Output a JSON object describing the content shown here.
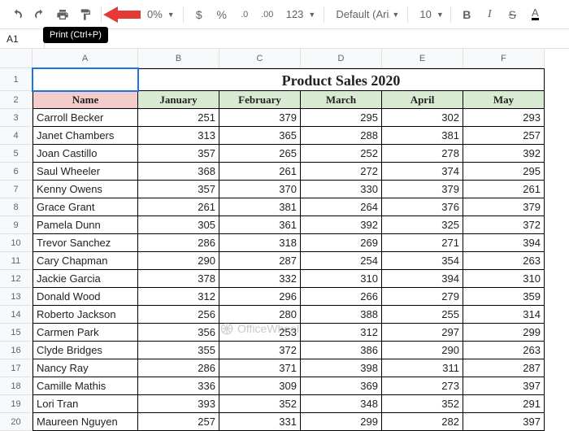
{
  "toolbar": {
    "zoom_tail": "0%",
    "format_123": "123",
    "font_name": "Default (Ari...",
    "font_size": "10"
  },
  "tooltip": {
    "print": "Print (Ctrl+P)"
  },
  "namebox": {
    "value": "A1"
  },
  "colHeaders": [
    "A",
    "B",
    "C",
    "D",
    "E",
    "F"
  ],
  "title": "Product Sales 2020",
  "headers": {
    "name": "Name",
    "months": [
      "January",
      "February",
      "March",
      "April",
      "May"
    ]
  },
  "rows": [
    {
      "n": 3,
      "name": "Carroll Becker",
      "v": [
        251,
        379,
        295,
        302,
        293
      ]
    },
    {
      "n": 4,
      "name": "Janet Chambers",
      "v": [
        313,
        365,
        288,
        381,
        257
      ]
    },
    {
      "n": 5,
      "name": "Joan Castillo",
      "v": [
        357,
        265,
        252,
        278,
        392
      ]
    },
    {
      "n": 6,
      "name": "Saul Wheeler",
      "v": [
        368,
        261,
        272,
        374,
        295
      ]
    },
    {
      "n": 7,
      "name": "Kenny Owens",
      "v": [
        357,
        370,
        330,
        379,
        261
      ]
    },
    {
      "n": 8,
      "name": "Grace Grant",
      "v": [
        261,
        381,
        264,
        376,
        379
      ]
    },
    {
      "n": 9,
      "name": "Pamela Dunn",
      "v": [
        305,
        361,
        392,
        325,
        372
      ]
    },
    {
      "n": 10,
      "name": "Trevor Sanchez",
      "v": [
        286,
        318,
        269,
        271,
        394
      ]
    },
    {
      "n": 11,
      "name": "Cary Chapman",
      "v": [
        290,
        287,
        254,
        354,
        263
      ]
    },
    {
      "n": 12,
      "name": "Jackie Garcia",
      "v": [
        378,
        332,
        310,
        394,
        310
      ]
    },
    {
      "n": 13,
      "name": "Donald Wood",
      "v": [
        312,
        296,
        266,
        279,
        359
      ]
    },
    {
      "n": 14,
      "name": "Roberto Jackson",
      "v": [
        256,
        280,
        388,
        255,
        314
      ]
    },
    {
      "n": 15,
      "name": "Carmen Park",
      "v": [
        356,
        253,
        312,
        297,
        299
      ]
    },
    {
      "n": 16,
      "name": "Clyde Bridges",
      "v": [
        355,
        372,
        386,
        290,
        263
      ]
    },
    {
      "n": 17,
      "name": "Nancy Ray",
      "v": [
        286,
        371,
        398,
        311,
        287
      ]
    },
    {
      "n": 18,
      "name": "Camille Mathis",
      "v": [
        336,
        309,
        369,
        273,
        397
      ]
    },
    {
      "n": 19,
      "name": "Lori Tran",
      "v": [
        393,
        352,
        348,
        352,
        291
      ]
    },
    {
      "n": 20,
      "name": "Maureen Nguyen",
      "v": [
        257,
        331,
        299,
        282,
        397
      ]
    }
  ],
  "watermark": "OfficeWheel",
  "chart_data": {
    "type": "table",
    "title": "Product Sales 2020",
    "columns": [
      "Name",
      "January",
      "February",
      "March",
      "April",
      "May"
    ],
    "rows": [
      [
        "Carroll Becker",
        251,
        379,
        295,
        302,
        293
      ],
      [
        "Janet Chambers",
        313,
        365,
        288,
        381,
        257
      ],
      [
        "Joan Castillo",
        357,
        265,
        252,
        278,
        392
      ],
      [
        "Saul Wheeler",
        368,
        261,
        272,
        374,
        295
      ],
      [
        "Kenny Owens",
        357,
        370,
        330,
        379,
        261
      ],
      [
        "Grace Grant",
        261,
        381,
        264,
        376,
        379
      ],
      [
        "Pamela Dunn",
        305,
        361,
        392,
        325,
        372
      ],
      [
        "Trevor Sanchez",
        286,
        318,
        269,
        271,
        394
      ],
      [
        "Cary Chapman",
        290,
        287,
        254,
        354,
        263
      ],
      [
        "Jackie Garcia",
        378,
        332,
        310,
        394,
        310
      ],
      [
        "Donald Wood",
        312,
        296,
        266,
        279,
        359
      ],
      [
        "Roberto Jackson",
        256,
        280,
        388,
        255,
        314
      ],
      [
        "Carmen Park",
        356,
        253,
        312,
        297,
        299
      ],
      [
        "Clyde Bridges",
        355,
        372,
        386,
        290,
        263
      ],
      [
        "Nancy Ray",
        286,
        371,
        398,
        311,
        287
      ],
      [
        "Camille Mathis",
        336,
        309,
        369,
        273,
        397
      ],
      [
        "Lori Tran",
        393,
        352,
        348,
        352,
        291
      ],
      [
        "Maureen Nguyen",
        257,
        331,
        299,
        282,
        397
      ]
    ]
  }
}
